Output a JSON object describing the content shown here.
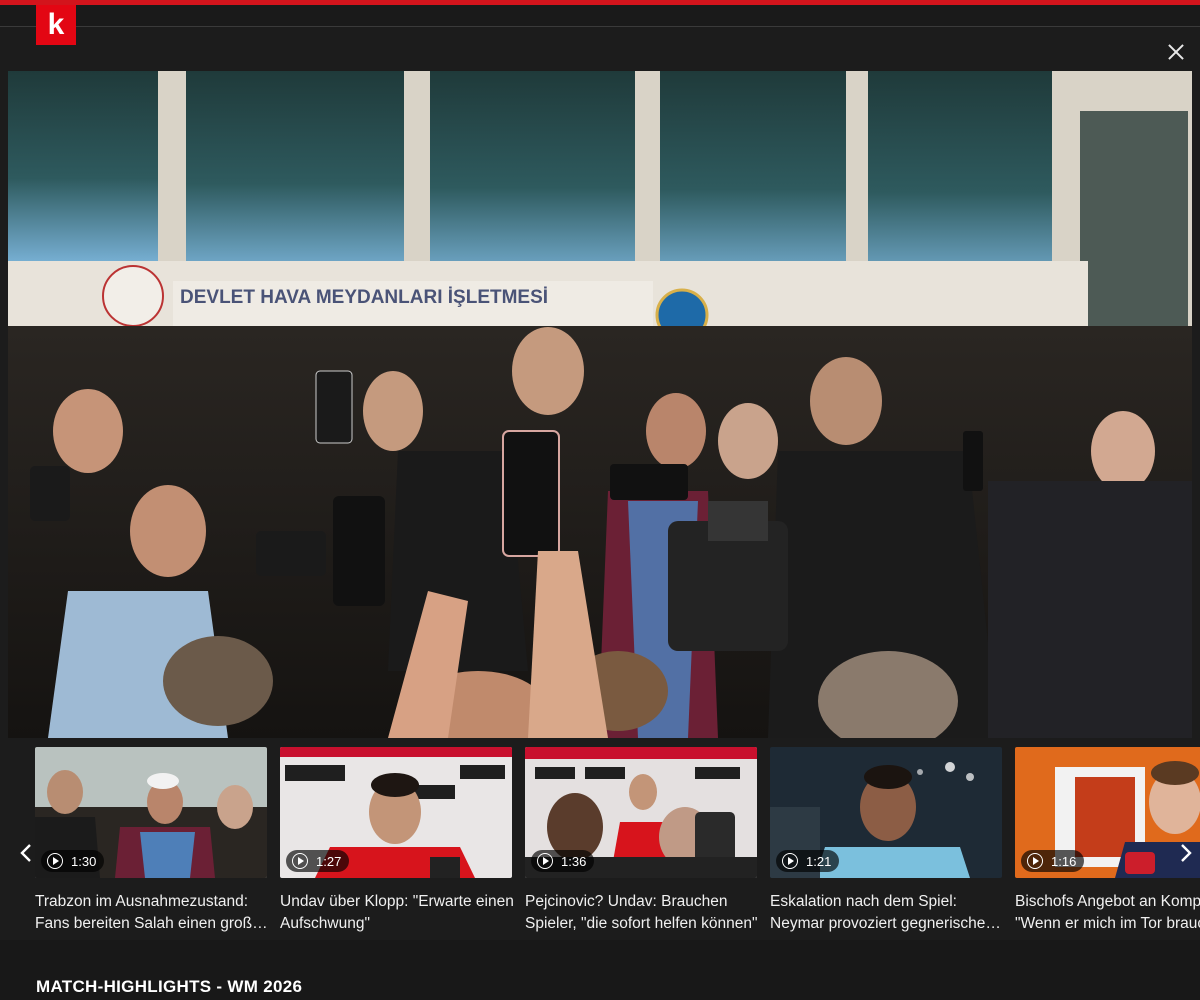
{
  "brand": {
    "logo_letter": "k",
    "accent": "#e30613"
  },
  "player": {
    "close_label": "×",
    "signage_text": "DEVLET HAVA MEYDANLARI İŞLETMESİ"
  },
  "carousel": {
    "prev_icon": "chevron-left-icon",
    "next_icon": "chevron-right-icon",
    "items": [
      {
        "duration": "1:30",
        "title_line1": "Trabzon im Ausnahmezustand:",
        "title_line2": "Fans bereiten Salah einen große…"
      },
      {
        "duration": "1:27",
        "title_line1": "Undav über Klopp: \"Erwarte einen",
        "title_line2": "Aufschwung\""
      },
      {
        "duration": "1:36",
        "title_line1": "Pejcinovic? Undav: Brauchen",
        "title_line2": "Spieler, \"die sofort helfen können\""
      },
      {
        "duration": "1:21",
        "title_line1": "Eskalation nach dem Spiel:",
        "title_line2": "Neymar provoziert gegnerische…"
      },
      {
        "duration": "1:16",
        "title_line1": "Bischofs Angebot an Kompa",
        "title_line2": "\"Wenn er mich im Tor brauc"
      }
    ]
  },
  "section": {
    "title": "MATCH-HIGHLIGHTS - WM 2026"
  }
}
